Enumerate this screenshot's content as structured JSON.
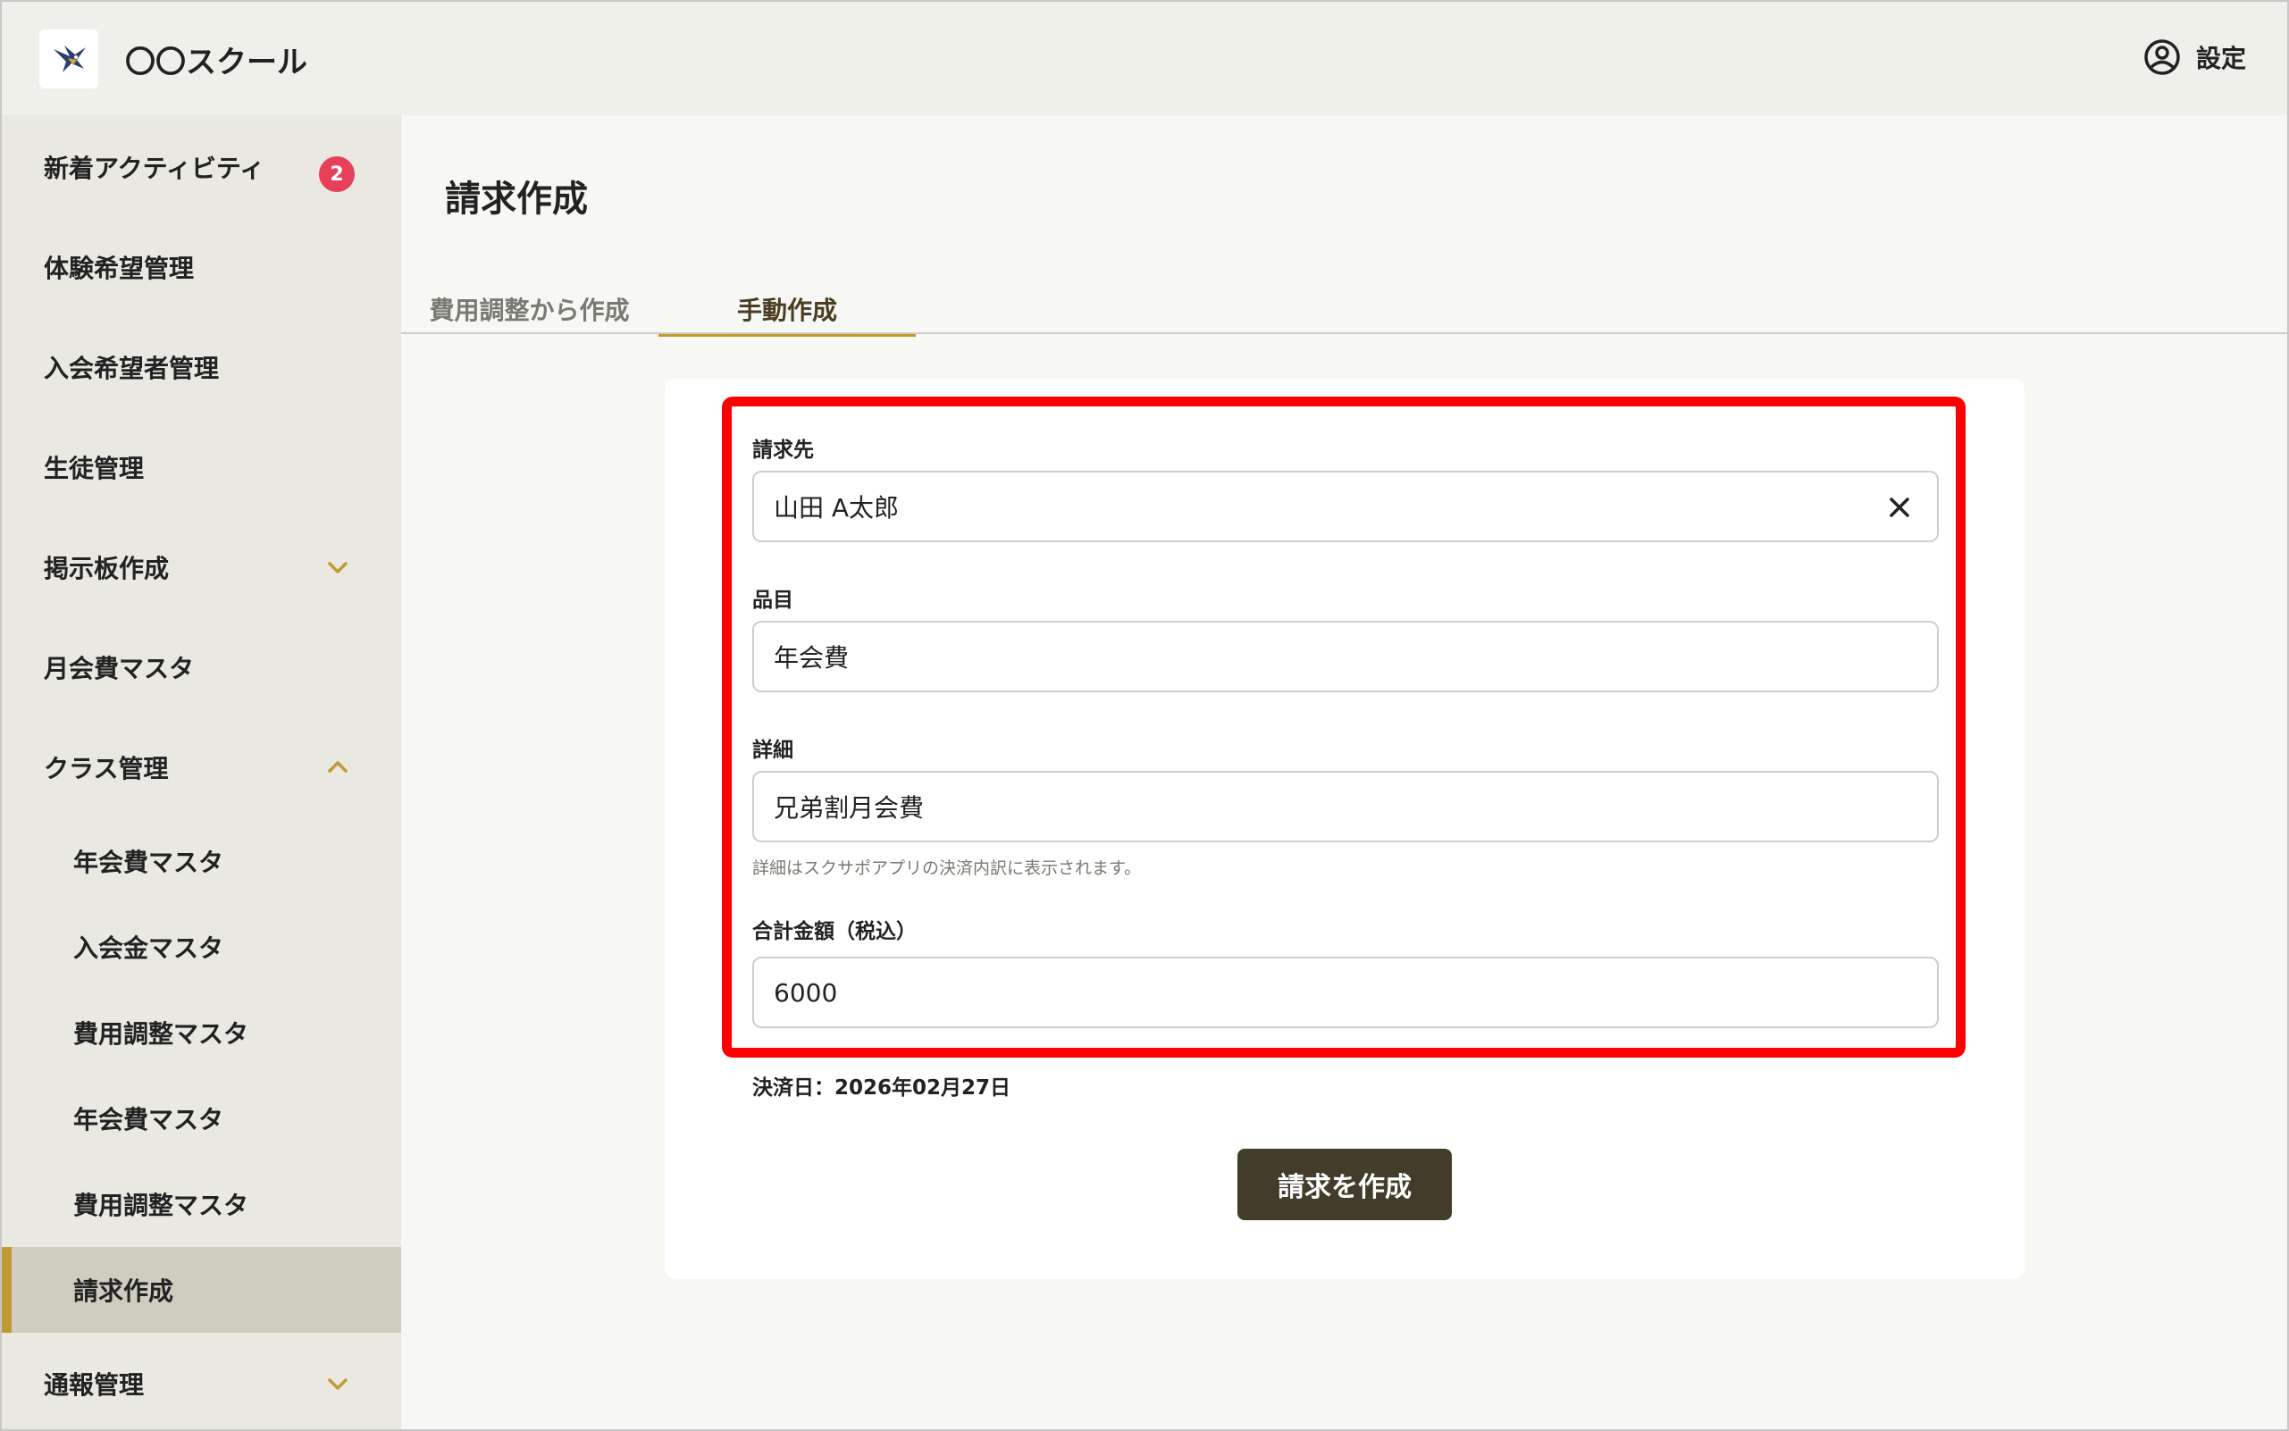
{
  "header": {
    "app_title": "〇〇スクール",
    "settings_label": "設定"
  },
  "sidebar": {
    "items": [
      {
        "label": "新着アクティビティ",
        "badge": "2"
      },
      {
        "label": "体験希望管理"
      },
      {
        "label": "入会希望者管理"
      },
      {
        "label": "生徒管理"
      },
      {
        "label": "掲示板作成"
      },
      {
        "label": "月会費マスタ"
      },
      {
        "label": "クラス管理"
      },
      {
        "label": "年会費マスタ"
      },
      {
        "label": "入会金マスタ"
      },
      {
        "label": "費用調整マスタ"
      },
      {
        "label": "年会費マスタ"
      },
      {
        "label": "費用調整マスタ"
      },
      {
        "label": "請求作成"
      },
      {
        "label": "通報管理"
      }
    ]
  },
  "main": {
    "title": "請求作成",
    "tabs": [
      {
        "label": "費用調整から作成"
      },
      {
        "label": "手動作成"
      }
    ],
    "form": {
      "recipient_label": "請求先",
      "recipient_value": "山田 A太郎",
      "item_label": "品目",
      "item_value": "年会費",
      "detail_label": "詳細",
      "detail_value": "兄弟割月会費",
      "detail_help": "詳細はスクサポアプリの決済内訳に表示されます。",
      "amount_label": "合計金額（税込）",
      "amount_value": "6000",
      "due_date": "決済日：2026年02月27日",
      "submit_label": "請求を作成"
    }
  },
  "colors": {
    "accent": "#c29a35",
    "badge": "#e8405a",
    "primary_button": "#423c2b",
    "highlight": "#ff0000"
  }
}
